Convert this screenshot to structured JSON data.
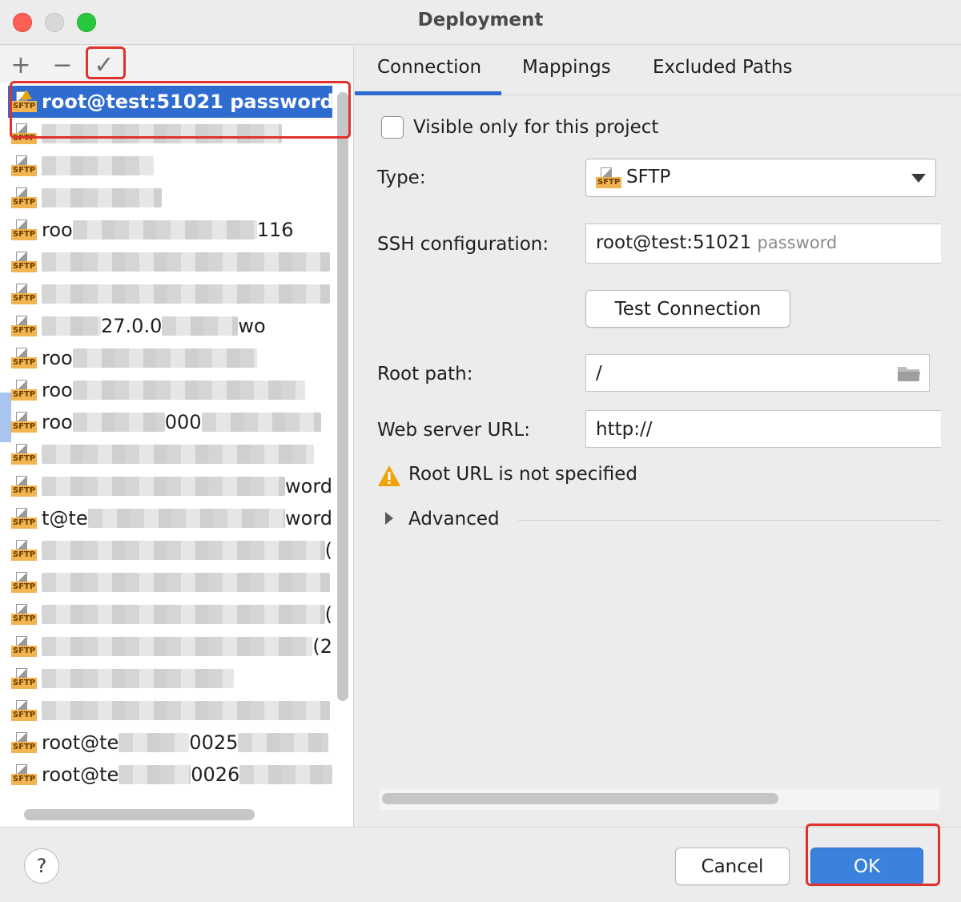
{
  "window": {
    "title": "Deployment"
  },
  "toolbar": {
    "add_glyph": "+",
    "remove_glyph": "−",
    "apply_glyph": "✓"
  },
  "servers": {
    "selected": {
      "name": "root@test:51021 password",
      "icon": "sftp-icon"
    },
    "rows": [
      {
        "visible_text": ""
      },
      {
        "visible_text": ""
      },
      {
        "visible_text": ""
      },
      {
        "visible_text": "roo",
        "suffix": "116"
      },
      {
        "visible_text": ""
      },
      {
        "visible_text": ""
      },
      {
        "visible_text": "",
        "middle": "27.0.0",
        "suffix": "wo"
      },
      {
        "visible_text": "roo"
      },
      {
        "visible_text": "roo"
      },
      {
        "visible_text": "roo",
        "middle": "000"
      },
      {
        "visible_text": ""
      },
      {
        "visible_text": "",
        "suffix": "word"
      },
      {
        "visible_text": "t@te",
        "suffix": "word"
      },
      {
        "visible_text": "",
        "suffix": "("
      },
      {
        "visible_text": ""
      },
      {
        "visible_text": "",
        "suffix": "("
      },
      {
        "visible_text": "",
        "suffix": "(2"
      },
      {
        "visible_text": ""
      },
      {
        "visible_text": ""
      },
      {
        "visible_text": "root@te",
        "middle": "0025"
      },
      {
        "visible_text": "root@te",
        "middle": "0026"
      }
    ],
    "icon_tag": "SFTP"
  },
  "tabs": [
    {
      "label": "Connection",
      "active": true
    },
    {
      "label": "Mappings",
      "active": false
    },
    {
      "label": "Excluded Paths",
      "active": false
    }
  ],
  "form": {
    "visible_only_label": "Visible only for this project",
    "visible_only_checked": false,
    "type_label": "Type:",
    "type_value": "SFTP",
    "ssh_label": "SSH configuration:",
    "ssh_value": "root@test:51021",
    "ssh_hint": "password",
    "test_connection_label": "Test Connection",
    "root_path_label": "Root path:",
    "root_path_value": "/",
    "web_url_label": "Web server URL:",
    "web_url_value": "http://",
    "warning_text": "Root URL is not specified",
    "advanced_label": "Advanced"
  },
  "footer": {
    "help_glyph": "?",
    "cancel_label": "Cancel",
    "ok_label": "OK"
  },
  "colors": {
    "accent": "#2f6ccf",
    "highlight": "#e0312d",
    "ok_button": "#3a82dd",
    "sftp_tag": "#f2b450",
    "warning": "#e8a500"
  }
}
